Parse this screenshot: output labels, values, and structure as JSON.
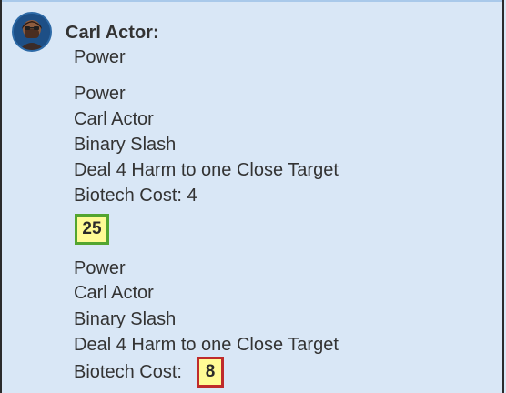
{
  "message": {
    "speaker": "Carl Actor:",
    "subtitle": "Power"
  },
  "cards": [
    {
      "type": "Power",
      "actor": "Carl Actor",
      "name": "Binary Slash",
      "effect": "Deal 4 Harm to one Close Target",
      "cost": "Biotech Cost: 4",
      "roll": "25"
    },
    {
      "type": "Power",
      "actor": "Carl Actor",
      "name": "Binary Slash",
      "effect": "Deal 4 Harm to one Close Target",
      "cost_label": "Biotech Cost:",
      "roll": "8"
    }
  ],
  "theme": {
    "background": "#d9e7f6",
    "success_border": "#53a52f",
    "fail_border": "#bf2b2b",
    "badge_bg": "#fffb95"
  }
}
